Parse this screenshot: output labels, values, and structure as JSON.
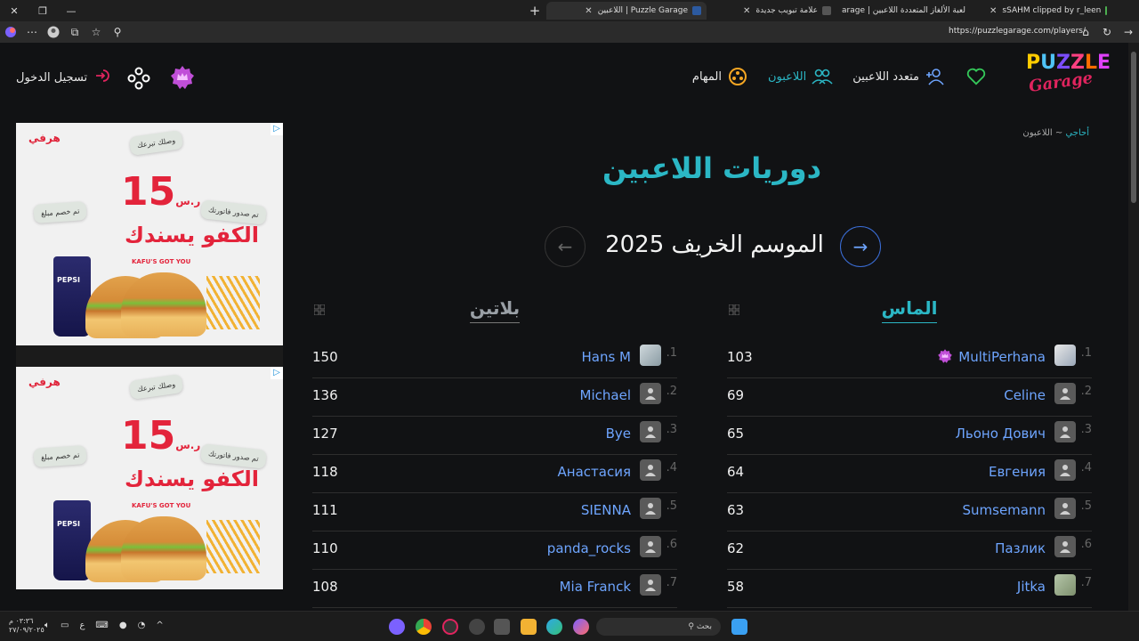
{
  "browser": {
    "tabs": [
      {
        "label": "sSAHM clipped by r_leen",
        "color": "#3a3a3a"
      },
      {
        "label": "لعبة الألغاز المتعددة اللاعبين | Puzzle Garage",
        "color": "#2c5aa0"
      },
      {
        "label": "علامة تبويب جديدة",
        "color": "#555"
      },
      {
        "label": "Puzzle Garage | اللاعبين",
        "color": "#2c5aa0"
      }
    ],
    "url": "https://puzzlegarage.com/players/"
  },
  "header": {
    "logo_top": "PUZZLE",
    "logo_bottom": "Garage",
    "nav": [
      {
        "label": "متعدد اللاعبين",
        "icon": "add-user-icon"
      },
      {
        "label": "اللاعبون",
        "icon": "players-icon",
        "active": true
      },
      {
        "label": "المهام",
        "icon": "tasks-icon"
      }
    ],
    "login_label": "تسجيل الدخول"
  },
  "breadcrumb": {
    "home": "أحاجي",
    "separator": "~",
    "current": "اللاعبون"
  },
  "page": {
    "title": "دوريات اللاعبين",
    "season": "الموسم الخريف 2025"
  },
  "leagues": [
    {
      "name": "الماس",
      "rows": [
        {
          "rank": ".1",
          "name": "MultiPerhana",
          "score": "103",
          "avatar": "photo3",
          "badge": true
        },
        {
          "rank": ".2",
          "name": "Celine",
          "score": "69",
          "avatar": "default"
        },
        {
          "rank": ".3",
          "name": "Льоно Дович",
          "score": "65",
          "avatar": "default"
        },
        {
          "rank": ".4",
          "name": "Евгения",
          "score": "64",
          "avatar": "default"
        },
        {
          "rank": ".5",
          "name": "Sumsemann",
          "score": "63",
          "avatar": "default"
        },
        {
          "rank": ".6",
          "name": "Пазлик",
          "score": "62",
          "avatar": "default"
        },
        {
          "rank": ".7",
          "name": "Jitka",
          "score": "58",
          "avatar": "photo2"
        }
      ]
    },
    {
      "name": "بلاتين",
      "rows": [
        {
          "rank": ".1",
          "name": "Hans M",
          "score": "150",
          "avatar": "photo"
        },
        {
          "rank": ".2",
          "name": "Michael",
          "score": "136",
          "avatar": "default"
        },
        {
          "rank": ".3",
          "name": "Bye",
          "score": "127",
          "avatar": "default"
        },
        {
          "rank": ".4",
          "name": "Анастасия",
          "score": "118",
          "avatar": "default"
        },
        {
          "rank": ".5",
          "name": "SIENNA",
          "score": "111",
          "avatar": "default"
        },
        {
          "rank": ".6",
          "name": "panda_rocks",
          "score": "110",
          "avatar": "default"
        },
        {
          "rank": ".7",
          "name": "Mia Franck",
          "score": "108",
          "avatar": "default"
        }
      ]
    }
  ],
  "ad": {
    "brand": "هرفي",
    "price": "15",
    "currency": "ر.س",
    "slogan": "الكفو يسندك",
    "slogan_en": "KAFU'S GOT YOU",
    "note1": "وصلك تبرعك",
    "note2": "تم صدور فاتورتك",
    "note3": "تم خصم مبلغ",
    "drink": "PEPSI"
  },
  "taskbar": {
    "search_placeholder": "بحث",
    "time": "٠٣:٣٦ م",
    "date": "٢٧/٠٩/٢٠٢٥",
    "lang": "ع"
  },
  "colors": {
    "accent": "#2bb7c5",
    "link": "#6ea5ff",
    "heart": "#34c759",
    "badge": "#c04fd8"
  }
}
